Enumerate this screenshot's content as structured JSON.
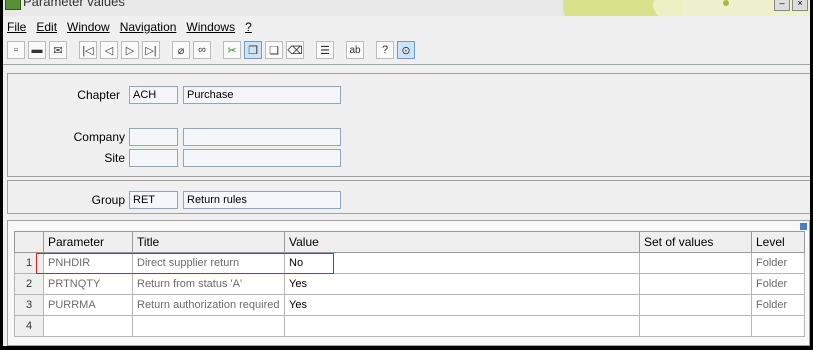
{
  "window": {
    "title": "Parameter values"
  },
  "menu": [
    {
      "label": "File"
    },
    {
      "label": "Edit"
    },
    {
      "label": "Window"
    },
    {
      "label": "Navigation"
    },
    {
      "label": "Windows"
    },
    {
      "label": "?"
    }
  ],
  "toolbar": {
    "icons": [
      "new-icon",
      "print-icon",
      "print-preview-icon",
      "first-icon",
      "previous-icon",
      "next-icon",
      "last-icon",
      "attach-icon",
      "link-icon",
      "cut-icon",
      "copy-icon",
      "paste-icon",
      "clear-icon",
      "list-icon",
      "text-field-icon",
      "help-icon",
      "search-help-icon"
    ]
  },
  "header": {
    "chapter": {
      "label": "Chapter",
      "code": "ACH",
      "desc": "Purchase"
    },
    "company": {
      "label": "Company",
      "code": "",
      "desc": ""
    },
    "site": {
      "label": "Site",
      "code": "",
      "desc": ""
    }
  },
  "group": {
    "label": "Group",
    "code": "RET",
    "desc": "Return rules"
  },
  "grid": {
    "columns": [
      "Parameter",
      "Title",
      "Value",
      "Set of values",
      "Level"
    ],
    "rows": [
      {
        "num": "1",
        "parameter": "PNHDIR",
        "title": "Direct supplier return",
        "value": "No",
        "set": "",
        "level": "Folder"
      },
      {
        "num": "2",
        "parameter": "PRTNQTY",
        "title": "Return from status 'A'",
        "value": "Yes",
        "set": "",
        "level": "Folder"
      },
      {
        "num": "3",
        "parameter": "PURRMA",
        "title": "Return authorization required",
        "value": "Yes",
        "set": "",
        "level": "Folder"
      },
      {
        "num": "4",
        "parameter": "",
        "title": "",
        "value": "",
        "set": "",
        "level": ""
      }
    ]
  }
}
